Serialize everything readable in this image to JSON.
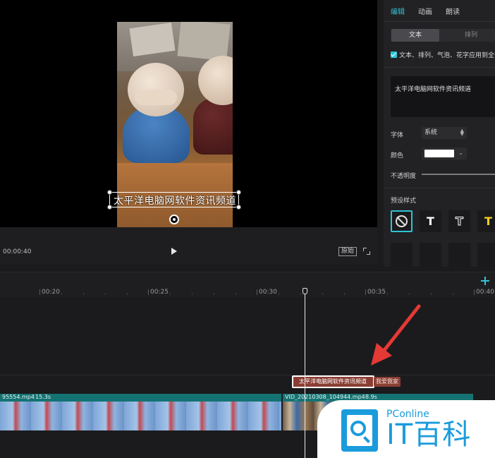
{
  "preview": {
    "subtitle": "太平洋电脑网软件资讯频道",
    "timecode": "00:00:40",
    "ratio_label": "原始"
  },
  "panel": {
    "tabs": [
      {
        "label": "编辑",
        "active": true
      },
      {
        "label": "动画",
        "active": false
      },
      {
        "label": "朗读",
        "active": false
      }
    ],
    "segments": [
      "文本",
      "排列"
    ],
    "apply_all": "文本、排列、气泡、花字应用到全部",
    "text_value": "太平洋电脑网软件资讯频道",
    "font_label": "字体",
    "font_value": "系统",
    "color_label": "颜色",
    "color_value": "#ffffff",
    "opacity_label": "不透明度",
    "preset_label": "预设样式",
    "preset_glyph": "T"
  },
  "timeline": {
    "ticks": [
      "00:20",
      "00:25",
      "00:30",
      "00:35",
      "00:40"
    ],
    "text_clips": [
      {
        "label": "太平洋电脑网软件资讯频道"
      },
      {
        "label": "我爱我家"
      }
    ],
    "video_clips": [
      {
        "name": "95554.mp4",
        "duration": "15.3s"
      },
      {
        "name": "VID_20210308_104944.mp4",
        "duration": "8.9s"
      }
    ]
  },
  "watermark": {
    "brand": "PConline",
    "title": "IT百科"
  },
  "colors": {
    "accent": "#2fc3d6",
    "text_clip": "#8a3e33",
    "video_clip": "#146c6a",
    "arrow": "#e53935",
    "watermark": "#1a9bdc"
  }
}
